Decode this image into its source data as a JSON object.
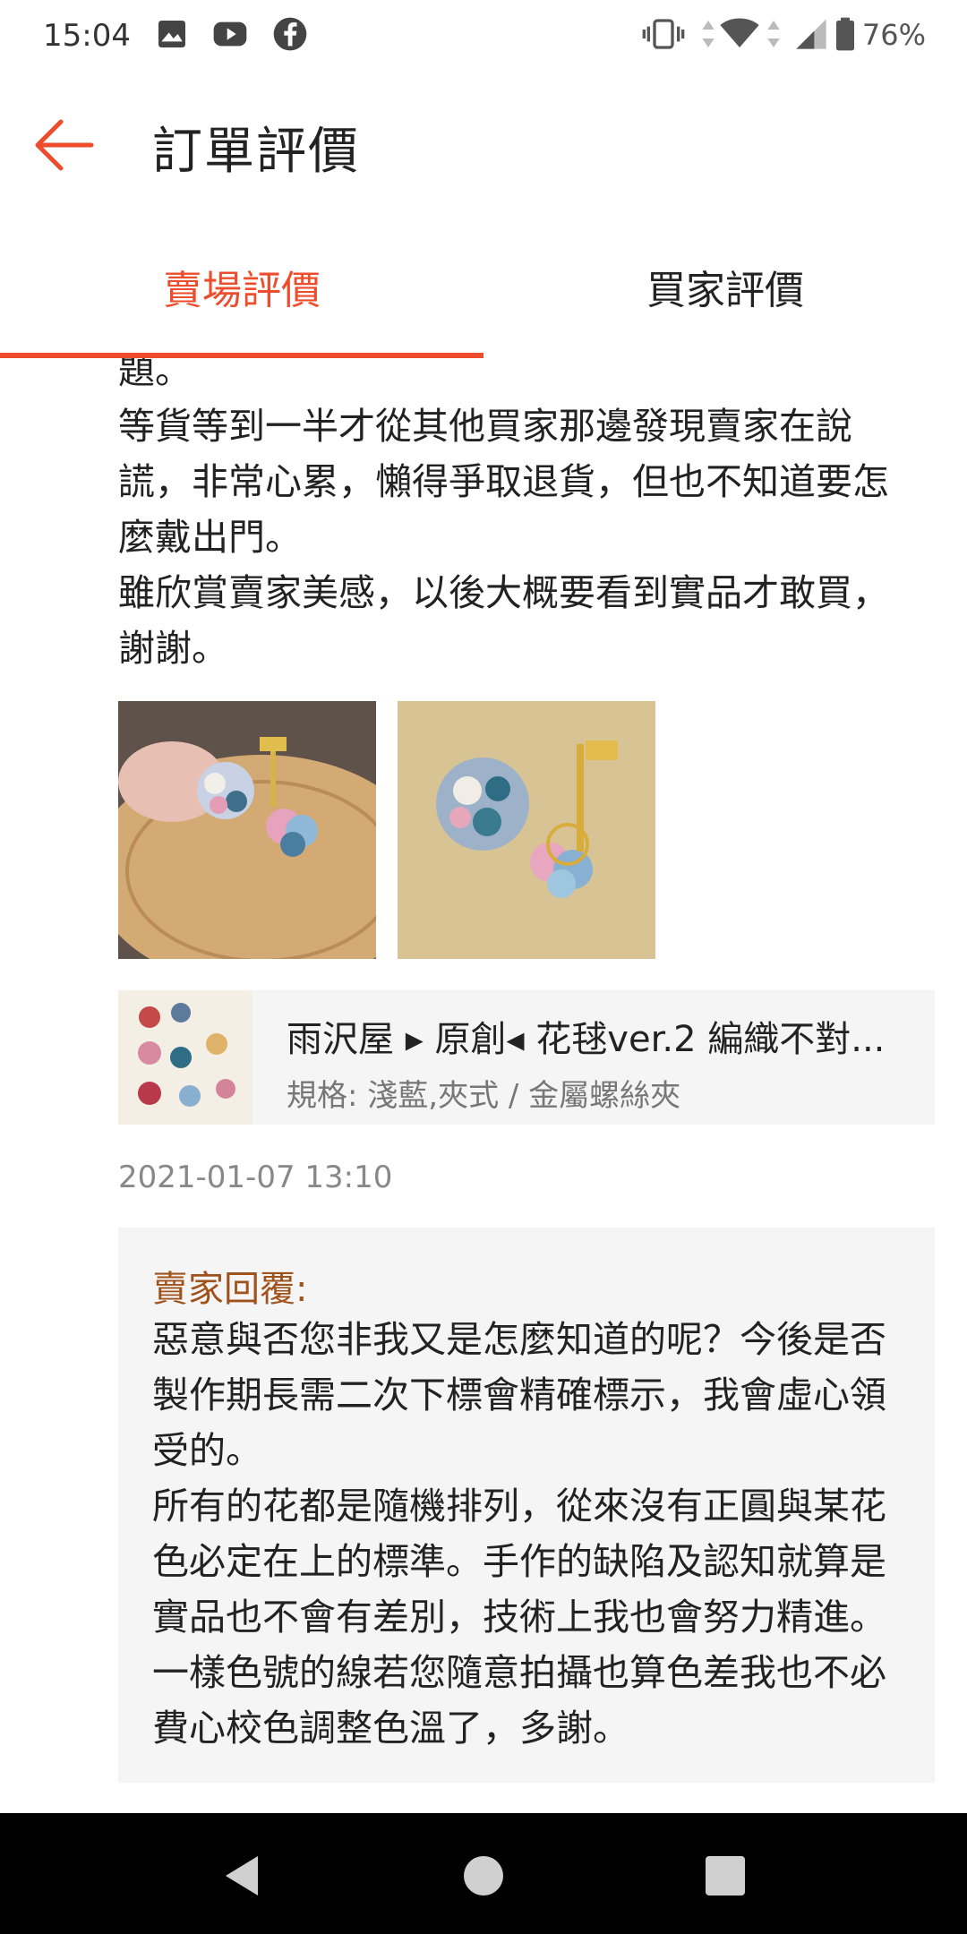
{
  "status_bar": {
    "time": "15:04",
    "battery_percent": "76%",
    "icons": [
      "image-icon",
      "youtube-icon",
      "facebook-icon",
      "vibrate-icon",
      "wifi-icon",
      "signal-icon",
      "battery-icon"
    ]
  },
  "app_bar": {
    "title": "訂單評價",
    "back_icon": "back-arrow-icon"
  },
  "tabs": [
    {
      "label": "賣場評價",
      "active": true
    },
    {
      "label": "買家評價",
      "active": false
    }
  ],
  "review": {
    "text_lines": "題。\n等貨等到一半才從其他買家那邊發現賣家在說謊，非常心累，懶得爭取退貨，但也不知道要怎麼戴出門。\n雖欣賞賣家美感，以後大概要看到實品才敢買，謝謝。",
    "photo_count": 2,
    "product": {
      "name": "雨沢屋 ▸ 原創◂ 花毬ver.2 編織不對...",
      "variant": "規格: 淺藍,夾式 / 金屬螺絲夾"
    },
    "date": "2021-01-07 13:10"
  },
  "seller_reply": {
    "label": "賣家回覆:",
    "text": "惡意與否您非我又是怎麼知道的呢？今後是否製作期長需二次下標會精確標示，我會虛心領受的。\n所有的花都是隨機排列，從來沒有正圓與某花色必定在上的標準。手作的缺陷及認知就算是實品也不會有差別，技術上我也會努力精進。一樣色號的線若您隨意拍攝也算色差我也不必費心校色調整色溫了，多謝。"
  },
  "colors": {
    "accent": "#ee4d2d",
    "reply_label": "#a0521c",
    "card_bg": "#f5f5f5"
  },
  "nav_bar": {
    "icons": [
      "back-triangle-icon",
      "home-circle-icon",
      "recents-square-icon"
    ]
  }
}
